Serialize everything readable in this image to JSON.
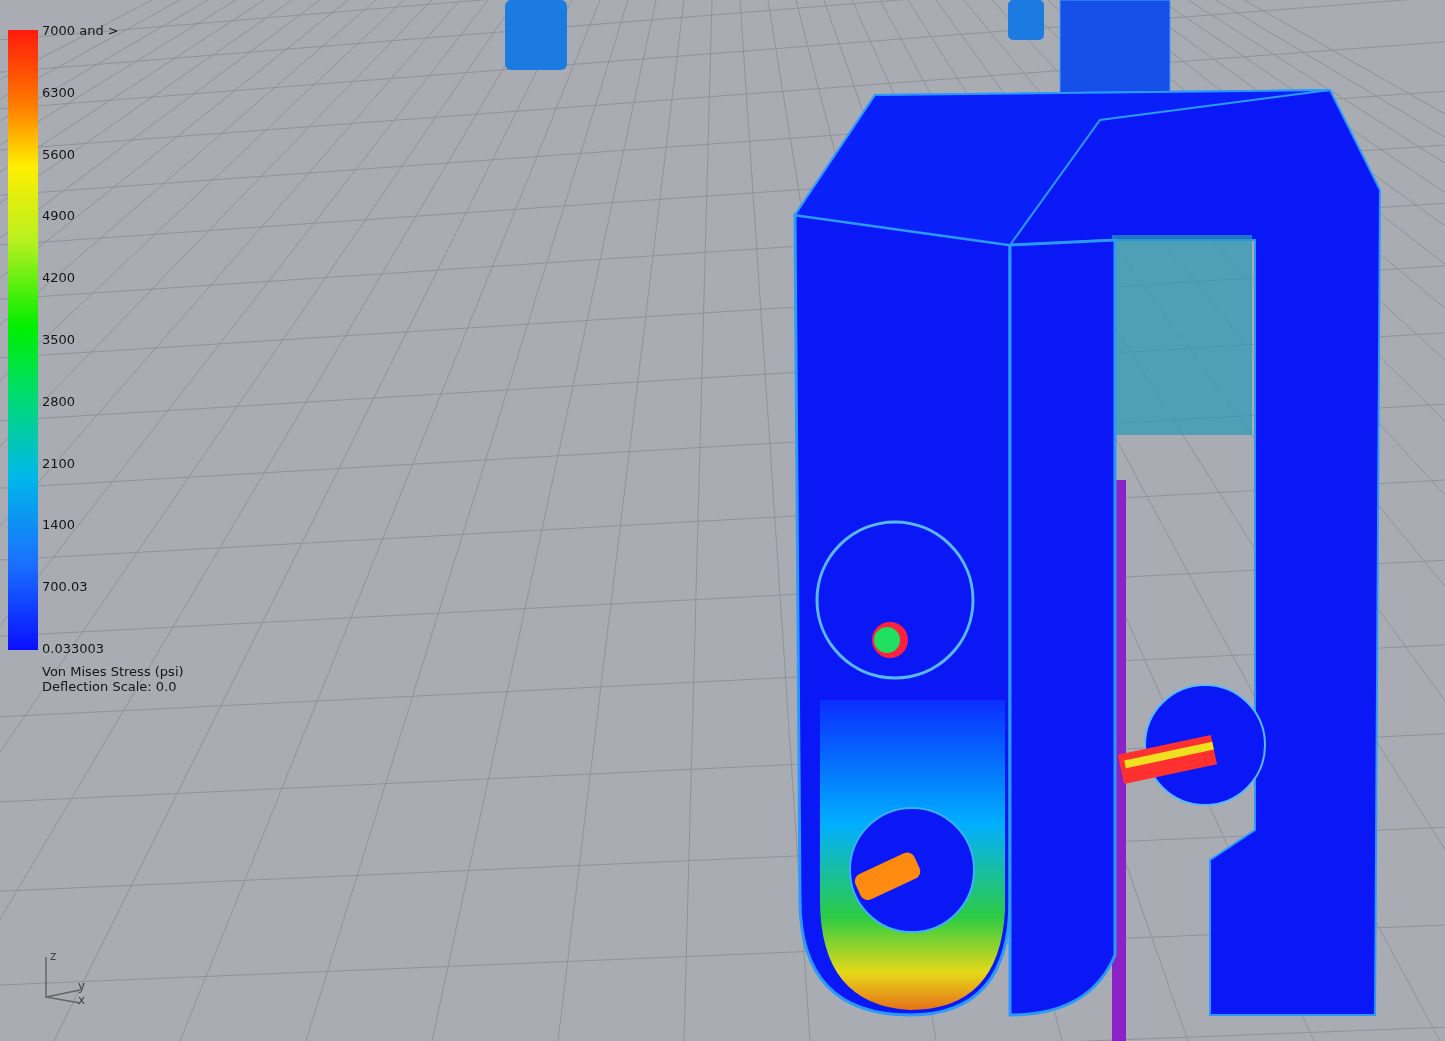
{
  "legend": {
    "labels": [
      "7000 and >",
      "6300",
      "5600",
      "4900",
      "4200",
      "3500",
      "2800",
      "2100",
      "1400",
      "700.03",
      "0.033003"
    ],
    "caption": [
      "Von Mises Stress (psi)",
      "Deflection Scale: 0.0"
    ]
  },
  "axes": {
    "z": "z",
    "y": "y",
    "x": "x"
  }
}
